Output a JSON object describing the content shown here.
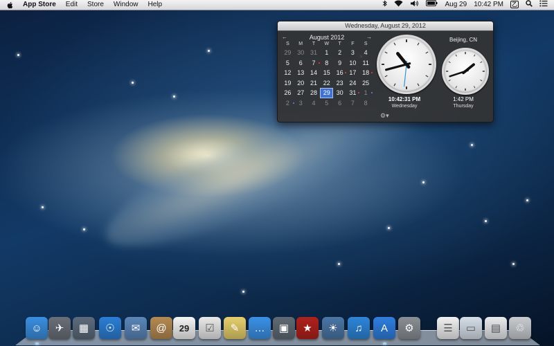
{
  "menubar": {
    "app_name": "App Store",
    "menus": [
      "Edit",
      "Store",
      "Window",
      "Help"
    ],
    "status": {
      "date": "Aug 29",
      "time": "10:42 PM",
      "input_badge": "㆚"
    },
    "icons": [
      "apple-icon",
      "bluetooth-icon",
      "wifi-icon",
      "volume-icon",
      "battery-icon",
      "input-source-icon",
      "spotlight-icon",
      "notification-center-icon"
    ]
  },
  "popover": {
    "header": "Wednesday, August 29, 2012",
    "calendar": {
      "prev": "←",
      "next": "→",
      "month_label": "August 2012",
      "weekdays": [
        "S",
        "M",
        "T",
        "W",
        "T",
        "F",
        "S"
      ],
      "weeks": [
        [
          {
            "d": "29",
            "dim": true
          },
          {
            "d": "30",
            "dim": true
          },
          {
            "d": "31",
            "dim": true
          },
          {
            "d": "1"
          },
          {
            "d": "2"
          },
          {
            "d": "3"
          },
          {
            "d": "4"
          }
        ],
        [
          {
            "d": "5"
          },
          {
            "d": "6"
          },
          {
            "d": "7",
            "dot": "red"
          },
          {
            "d": "8"
          },
          {
            "d": "9"
          },
          {
            "d": "10"
          },
          {
            "d": "11"
          }
        ],
        [
          {
            "d": "12"
          },
          {
            "d": "13"
          },
          {
            "d": "14"
          },
          {
            "d": "15"
          },
          {
            "d": "16",
            "dot": "red"
          },
          {
            "d": "17"
          },
          {
            "d": "18",
            "dot": "red"
          }
        ],
        [
          {
            "d": "19"
          },
          {
            "d": "20"
          },
          {
            "d": "21"
          },
          {
            "d": "22"
          },
          {
            "d": "23"
          },
          {
            "d": "24"
          },
          {
            "d": "25"
          }
        ],
        [
          {
            "d": "26"
          },
          {
            "d": "27"
          },
          {
            "d": "28"
          },
          {
            "d": "29",
            "today": true
          },
          {
            "d": "30"
          },
          {
            "d": "31",
            "dot": "red"
          },
          {
            "d": "1",
            "dim": true,
            "dot": "blue"
          }
        ],
        [
          {
            "d": "2",
            "dim": true,
            "dot": "blue"
          },
          {
            "d": "3",
            "dim": true
          },
          {
            "d": "4",
            "dim": true
          },
          {
            "d": "5",
            "dim": true
          },
          {
            "d": "6",
            "dim": true
          },
          {
            "d": "7",
            "dim": true
          },
          {
            "d": "8",
            "dim": true
          }
        ]
      ]
    },
    "clock_main": {
      "time": "10:42:31 PM",
      "day": "Wednesday",
      "hour": 10,
      "minute": 42,
      "second": 31
    },
    "clock_beijing": {
      "city": "Beijing, CN",
      "time": "1:42 PM",
      "day": "Thursday",
      "hour": 1,
      "minute": 42
    }
  },
  "dock": {
    "apps": [
      {
        "name": "finder-icon",
        "glyph": "☺",
        "color": "#3a8fe0",
        "running": true
      },
      {
        "name": "launchpad-icon",
        "glyph": "✈",
        "color": "#6a6f78"
      },
      {
        "name": "mission-control-icon",
        "glyph": "▦",
        "color": "#5d6b7c"
      },
      {
        "name": "safari-icon",
        "glyph": "☉",
        "color": "#2b7fd6"
      },
      {
        "name": "mail-icon",
        "glyph": "✉",
        "color": "#5a86b8"
      },
      {
        "name": "contacts-icon",
        "glyph": "@",
        "color": "#b58a52"
      },
      {
        "name": "calendar-icon",
        "glyph": "29",
        "color": "#f4f4f4"
      },
      {
        "name": "reminders-icon",
        "glyph": "☑",
        "color": "#e9e9e9"
      },
      {
        "name": "notes-icon",
        "glyph": "✎",
        "color": "#e6cf6a"
      },
      {
        "name": "messages-icon",
        "glyph": "…",
        "color": "#3b91e6"
      },
      {
        "name": "facetime-icon",
        "glyph": "▣",
        "color": "#5f6a74"
      },
      {
        "name": "photo-booth-icon",
        "glyph": "★",
        "color": "#b0211c"
      },
      {
        "name": "iphoto-icon",
        "glyph": "☀",
        "color": "#4a76a5"
      },
      {
        "name": "itunes-icon",
        "glyph": "♫",
        "color": "#2d86d9"
      },
      {
        "name": "app-store-icon",
        "glyph": "A",
        "color": "#2e7fe0",
        "running": true
      },
      {
        "name": "system-preferences-icon",
        "glyph": "⚙",
        "color": "#8a8f95"
      },
      {
        "name": "document-preview-icon",
        "glyph": "☰",
        "color": "#f1f1f1"
      },
      {
        "name": "screen-capture-icon",
        "glyph": "▭",
        "color": "#d6dfe9"
      },
      {
        "name": "downloads-stack-icon",
        "glyph": "▤",
        "color": "#e8eaed"
      },
      {
        "name": "trash-icon",
        "glyph": "♲",
        "color": "#c8ccd0"
      }
    ]
  },
  "colors": {
    "accent": "#3d73d9",
    "event_dot": "#ff3a3a"
  }
}
